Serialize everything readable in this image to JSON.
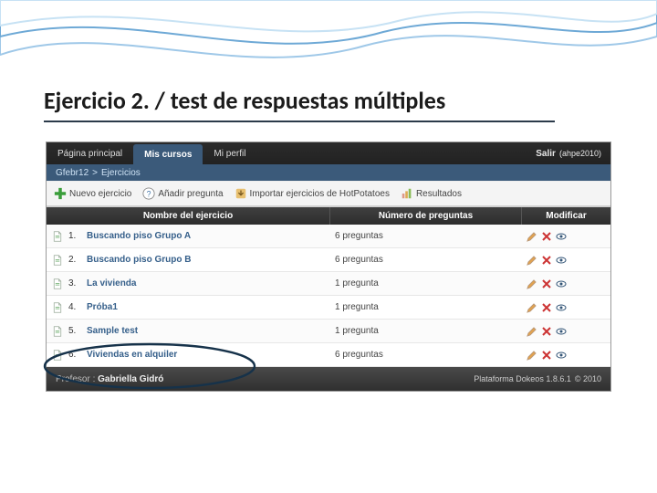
{
  "slide": {
    "title": "Ejercicio 2. / test de respuestas múltiples"
  },
  "nav": {
    "home": "Página principal",
    "courses": "Mis cursos",
    "profile": "Mi perfil",
    "logout": "Salir",
    "user": "(ahpe2010)"
  },
  "breadcrumb": {
    "course": "Gfebr12",
    "sep": ">",
    "section": "Ejercicios"
  },
  "toolbar": {
    "new_exercise": "Nuevo ejercicio",
    "add_question": "Añadir pregunta",
    "import_hot": "Importar ejercicios de HotPotatoes",
    "results": "Resultados"
  },
  "table": {
    "headers": {
      "name": "Nombre del ejercicio",
      "count": "Número de preguntas",
      "modify": "Modificar"
    },
    "rows": [
      {
        "n": "1.",
        "title": "Buscando piso Grupo A",
        "count": "6 preguntas"
      },
      {
        "n": "2.",
        "title": "Buscando piso Grupo B",
        "count": "6 preguntas"
      },
      {
        "n": "3.",
        "title": "La vivienda",
        "count": "1 pregunta"
      },
      {
        "n": "4.",
        "title": "Próba1",
        "count": "1 pregunta"
      },
      {
        "n": "5.",
        "title": "Sample test",
        "count": "1 pregunta"
      },
      {
        "n": "6.",
        "title": "Viviendas en alquiler",
        "count": "6 preguntas"
      }
    ]
  },
  "footer": {
    "role": "Profesor :",
    "name": "Gabriella Gidró",
    "platform": "Plataforma Dokeos 1.8.6.1",
    "copyright": "© 2010"
  },
  "icons": {
    "new": "plus-icon",
    "question": "question-icon",
    "import": "import-icon",
    "results": "chart-icon",
    "doc": "document-icon",
    "edit": "pencil-icon",
    "delete": "x-icon",
    "visibility": "eye-icon"
  },
  "colors": {
    "nav_active": "#3b5a7a",
    "link": "#355f8a"
  }
}
